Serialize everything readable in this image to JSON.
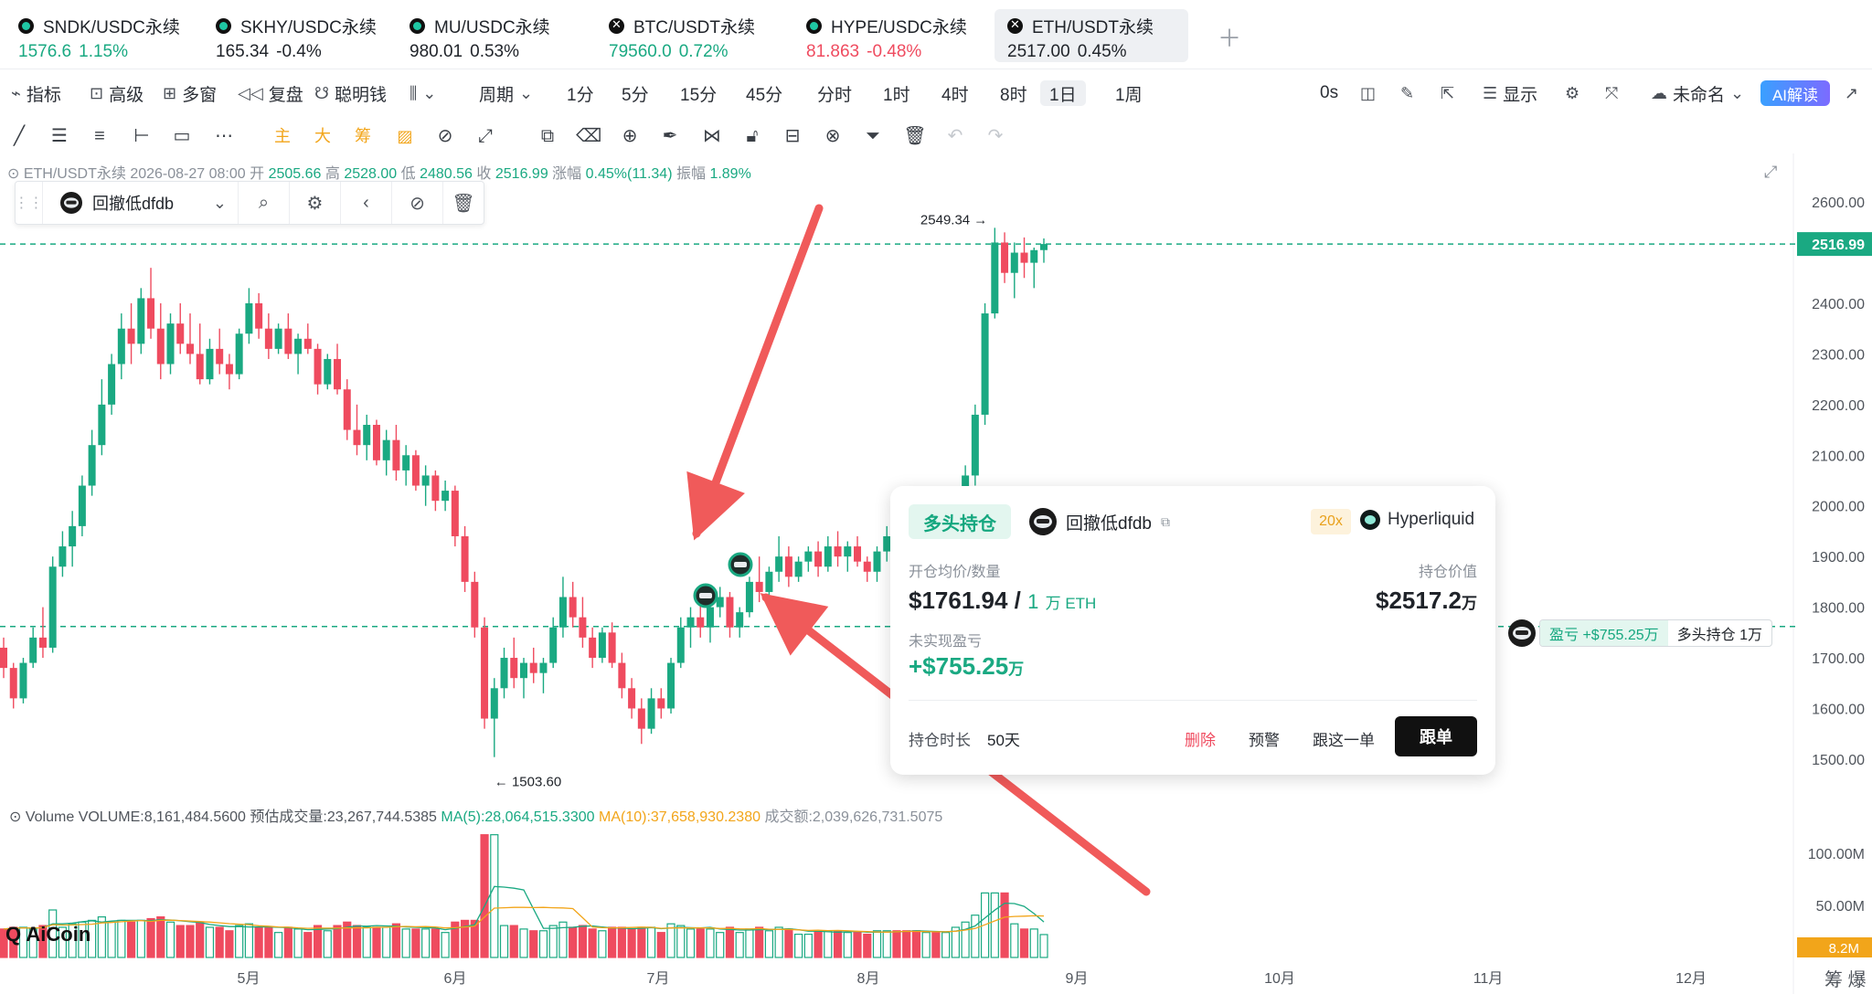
{
  "tickers": [
    {
      "name": "SNDK/USDC永续",
      "price": "1576.6",
      "change": "1.15%",
      "dir": "up",
      "icon": "x"
    },
    {
      "name": "SKHY/USDC永续",
      "price": "165.34",
      "change": "-0.4%",
      "dir": "flat",
      "icon": "x"
    },
    {
      "name": "MU/USDC永续",
      "price": "980.01",
      "change": "0.53%",
      "dir": "flat",
      "icon": "x"
    },
    {
      "name": "BTC/USDT永续",
      "price": "79560.0",
      "change": "0.72%",
      "dir": "up",
      "icon": "x"
    },
    {
      "name": "HYPE/USDC永续",
      "price": "81.863",
      "change": "-0.48%",
      "dir": "down",
      "icon": "x"
    },
    {
      "name": "ETH/USDT永续",
      "price": "2517.00",
      "change": "0.45%",
      "dir": "flat",
      "icon": "x",
      "active": true
    }
  ],
  "toolbar": {
    "indicators": "指标",
    "advanced": "高级",
    "multi_window": "多窗",
    "replay": "复盘",
    "smart_money": "聪明钱",
    "period_label": "周期",
    "periods": [
      "1分",
      "5分",
      "15分",
      "45分",
      "分时",
      "1时",
      "4时",
      "8时",
      "1日",
      "1周"
    ],
    "selected_period": "1日",
    "timer": "0s",
    "display": "显示",
    "layout_name": "未命名",
    "ai_button": "AI解读"
  },
  "drawing_tools": {
    "main": "主",
    "big": "大",
    "chips": "筹"
  },
  "ohlc": {
    "symbol": "ETH/USDT永续",
    "date": "2026-08-27 08:00",
    "open_label": "开",
    "open": "2505.66",
    "high_label": "高",
    "high": "2528.00",
    "low_label": "低",
    "low": "2480.56",
    "close_label": "收",
    "close": "2516.99",
    "change_label": "涨幅",
    "change": "0.45%(11.34)",
    "amp_label": "振幅",
    "amp": "1.89%"
  },
  "indicator_bar": {
    "name": "回撤低dfdb"
  },
  "annotations": {
    "high_marker": "2549.34 →",
    "low_marker": "← 1503.60"
  },
  "price_axis": {
    "labels": [
      "2600.00",
      "2400.00",
      "2300.00",
      "2200.00",
      "2100.00",
      "2000.00",
      "1900.00",
      "1800.00",
      "1700.00",
      "1600.00",
      "1500.00"
    ],
    "current_price": "2516.99",
    "vol_labels": [
      "100.00M",
      "50.00M"
    ],
    "current_vol": "8.2M"
  },
  "time_axis": [
    "5月",
    "6月",
    "7月",
    "8月",
    "9月",
    "10月",
    "11月",
    "12月"
  ],
  "position_card": {
    "badge": "多头持仓",
    "trader": "回撤低dfdb",
    "leverage": "20x",
    "exchange": "Hyperliquid",
    "entry_label": "开仓均价/数量",
    "entry_price": "$1761.94",
    "qty": "1",
    "qty_unit": "万 ETH",
    "value_label": "持仓价值",
    "value": "$2517.2",
    "value_unit": "万",
    "pnl_label": "未实现盈亏",
    "pnl": "+$755.25",
    "pnl_unit": "万",
    "hold_label": "持仓时长",
    "hold_days": "50天",
    "actions": {
      "delete": "删除",
      "alert": "预警",
      "follow_one": "跟这一单",
      "copy_trade": "跟单"
    }
  },
  "position_pill": {
    "pnl": "盈亏 +$755.25万",
    "side": "多头持仓 1万"
  },
  "volume": {
    "title": "Volume",
    "volume": "VOLUME:8,161,484.5600",
    "est": "预估成交量:23,267,744.5385",
    "ma5": "MA(5):28,064,515.3300",
    "ma10": "MA(10):37,658,930.2380",
    "amount": "成交额:2,039,626,731.5075"
  },
  "logo": "AiCoin",
  "corner_text": "筹 爆",
  "chart_data": {
    "type": "candlestick",
    "candles": [
      [
        1720,
        1740,
        1660,
        1680
      ],
      [
        1680,
        1690,
        1600,
        1620
      ],
      [
        1620,
        1700,
        1610,
        1690
      ],
      [
        1690,
        1760,
        1680,
        1740
      ],
      [
        1740,
        1800,
        1700,
        1720
      ],
      [
        1720,
        1900,
        1710,
        1880
      ],
      [
        1880,
        1950,
        1860,
        1920
      ],
      [
        1920,
        1990,
        1880,
        1960
      ],
      [
        1960,
        2060,
        1940,
        2040
      ],
      [
        2040,
        2150,
        2020,
        2120
      ],
      [
        2120,
        2250,
        2100,
        2200
      ],
      [
        2200,
        2300,
        2180,
        2280
      ],
      [
        2280,
        2380,
        2250,
        2350
      ],
      [
        2350,
        2400,
        2280,
        2320
      ],
      [
        2320,
        2430,
        2300,
        2410
      ],
      [
        2410,
        2470,
        2330,
        2350
      ],
      [
        2350,
        2400,
        2250,
        2280
      ],
      [
        2280,
        2380,
        2260,
        2360
      ],
      [
        2360,
        2400,
        2300,
        2320
      ],
      [
        2320,
        2380,
        2280,
        2300
      ],
      [
        2300,
        2360,
        2240,
        2250
      ],
      [
        2250,
        2330,
        2240,
        2310
      ],
      [
        2310,
        2350,
        2260,
        2280
      ],
      [
        2280,
        2300,
        2230,
        2260
      ],
      [
        2260,
        2350,
        2250,
        2340
      ],
      [
        2340,
        2430,
        2320,
        2400
      ],
      [
        2400,
        2420,
        2330,
        2350
      ],
      [
        2350,
        2380,
        2290,
        2310
      ],
      [
        2310,
        2360,
        2300,
        2350
      ],
      [
        2350,
        2380,
        2290,
        2300
      ],
      [
        2300,
        2340,
        2260,
        2330
      ],
      [
        2330,
        2360,
        2300,
        2310
      ],
      [
        2310,
        2320,
        2220,
        2240
      ],
      [
        2240,
        2300,
        2230,
        2290
      ],
      [
        2290,
        2320,
        2220,
        2230
      ],
      [
        2230,
        2250,
        2130,
        2150
      ],
      [
        2150,
        2200,
        2100,
        2120
      ],
      [
        2120,
        2180,
        2090,
        2160
      ],
      [
        2160,
        2170,
        2080,
        2090
      ],
      [
        2090,
        2150,
        2060,
        2130
      ],
      [
        2130,
        2160,
        2050,
        2070
      ],
      [
        2070,
        2120,
        2040,
        2100
      ],
      [
        2100,
        2110,
        2030,
        2040
      ],
      [
        2040,
        2080,
        2000,
        2060
      ],
      [
        2060,
        2070,
        1990,
        2010
      ],
      [
        2010,
        2050,
        1990,
        2030
      ],
      [
        2030,
        2040,
        1920,
        1940
      ],
      [
        1940,
        1960,
        1830,
        1850
      ],
      [
        1850,
        1870,
        1740,
        1760
      ],
      [
        1760,
        1780,
        1560,
        1580
      ],
      [
        1580,
        1660,
        1504,
        1640
      ],
      [
        1640,
        1720,
        1620,
        1700
      ],
      [
        1700,
        1740,
        1640,
        1660
      ],
      [
        1660,
        1700,
        1620,
        1690
      ],
      [
        1690,
        1720,
        1650,
        1670
      ],
      [
        1670,
        1700,
        1630,
        1690
      ],
      [
        1690,
        1780,
        1680,
        1760
      ],
      [
        1760,
        1860,
        1740,
        1820
      ],
      [
        1820,
        1850,
        1760,
        1780
      ],
      [
        1780,
        1820,
        1720,
        1740
      ],
      [
        1740,
        1760,
        1680,
        1700
      ],
      [
        1700,
        1760,
        1690,
        1750
      ],
      [
        1750,
        1770,
        1680,
        1690
      ],
      [
        1690,
        1710,
        1620,
        1640
      ],
      [
        1640,
        1660,
        1580,
        1600
      ],
      [
        1600,
        1620,
        1530,
        1560
      ],
      [
        1560,
        1640,
        1550,
        1620
      ],
      [
        1620,
        1640,
        1580,
        1600
      ],
      [
        1600,
        1700,
        1590,
        1690
      ],
      [
        1690,
        1780,
        1680,
        1760
      ],
      [
        1760,
        1800,
        1720,
        1780
      ],
      [
        1780,
        1820,
        1740,
        1760
      ],
      [
        1760,
        1810,
        1730,
        1800
      ],
      [
        1800,
        1840,
        1780,
        1820
      ],
      [
        1820,
        1830,
        1740,
        1760
      ],
      [
        1760,
        1800,
        1740,
        1790
      ],
      [
        1790,
        1860,
        1780,
        1850
      ],
      [
        1850,
        1900,
        1810,
        1830
      ],
      [
        1830,
        1880,
        1810,
        1870
      ],
      [
        1870,
        1940,
        1850,
        1900
      ],
      [
        1900,
        1920,
        1840,
        1860
      ],
      [
        1860,
        1900,
        1850,
        1890
      ],
      [
        1890,
        1920,
        1870,
        1910
      ],
      [
        1910,
        1930,
        1860,
        1880
      ],
      [
        1880,
        1940,
        1870,
        1920
      ],
      [
        1920,
        1950,
        1880,
        1900
      ],
      [
        1900,
        1930,
        1870,
        1920
      ],
      [
        1920,
        1940,
        1880,
        1890
      ],
      [
        1890,
        1900,
        1850,
        1870
      ],
      [
        1870,
        1920,
        1850,
        1910
      ],
      [
        1910,
        1960,
        1890,
        1940
      ],
      [
        1940,
        1970,
        1900,
        1920
      ],
      [
        1920,
        1950,
        1880,
        1900
      ],
      [
        1900,
        1920,
        1850,
        1870
      ],
      [
        1870,
        1900,
        1840,
        1890
      ],
      [
        1890,
        1920,
        1860,
        1880
      ],
      [
        1880,
        1930,
        1870,
        1920
      ],
      [
        1920,
        1990,
        1900,
        1980
      ],
      [
        1980,
        2080,
        1960,
        2060
      ],
      [
        2060,
        2200,
        2040,
        2180
      ],
      [
        2180,
        2400,
        2160,
        2380
      ],
      [
        2380,
        2549,
        2370,
        2520
      ],
      [
        2520,
        2540,
        2440,
        2460
      ],
      [
        2460,
        2520,
        2410,
        2500
      ],
      [
        2500,
        2530,
        2450,
        2480
      ],
      [
        2480,
        2510,
        2430,
        2505
      ],
      [
        2505,
        2528,
        2480,
        2517
      ]
    ],
    "ylim": [
      1480,
      2620
    ],
    "xlabels": [
      "5月",
      "6月",
      "7月",
      "8月",
      "9月",
      "10月",
      "11月",
      "12月"
    ]
  }
}
